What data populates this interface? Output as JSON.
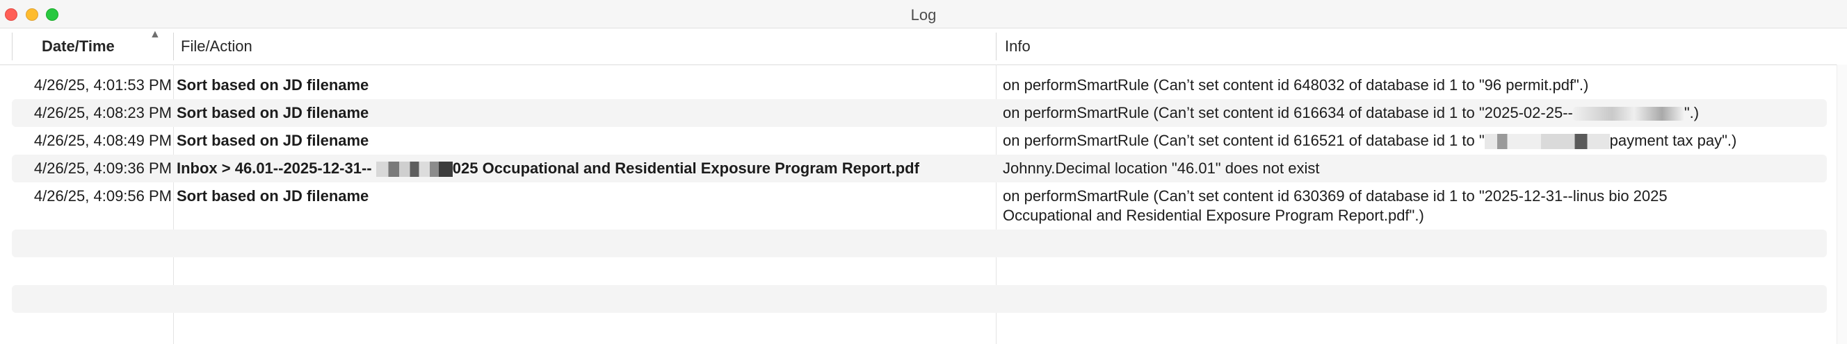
{
  "window": {
    "title": "Log"
  },
  "header": {
    "columns": [
      "Date/Time",
      "File/Action",
      "Info"
    ],
    "sort_indicator": "▲"
  },
  "rows": [
    {
      "date": "4/26/25, 4:01:53 PM",
      "file": "Sort based on JD filename",
      "info": "on performSmartRule (Can’t set content id 648032 of database id 1 to \"96 permit.pdf\".)"
    },
    {
      "date": "4/26/25, 4:08:23 PM",
      "file": "Sort based on JD filename",
      "info_prefix": "on performSmartRule (Can’t set content id 616634 of database id 1 to \"2025-02-25--",
      "info_suffix": "\".)"
    },
    {
      "date": "4/26/25, 4:08:49 PM",
      "file": "Sort based on JD filename",
      "info_prefix": "on performSmartRule (Can’t set content id 616521 of database id 1 to \"",
      "info_suffix": "payment tax pay\".)"
    },
    {
      "date": "4/26/25, 4:09:36 PM",
      "file_prefix": "Inbox > 46.01--2025-12-31--",
      "file_suffix": "025 Occupational and Residential Exposure Program Report.pdf",
      "info": "Johnny.Decimal location \"46.01\" does not exist"
    },
    {
      "date": "4/26/25, 4:09:56 PM",
      "file": "Sort based on JD filename",
      "info_line1": "on performSmartRule (Can’t set content id 630369 of database id 1 to \"2025-12-31--linus bio 2025",
      "info_line2": "Occupational and Residential Exposure Program Report.pdf\".)"
    }
  ]
}
